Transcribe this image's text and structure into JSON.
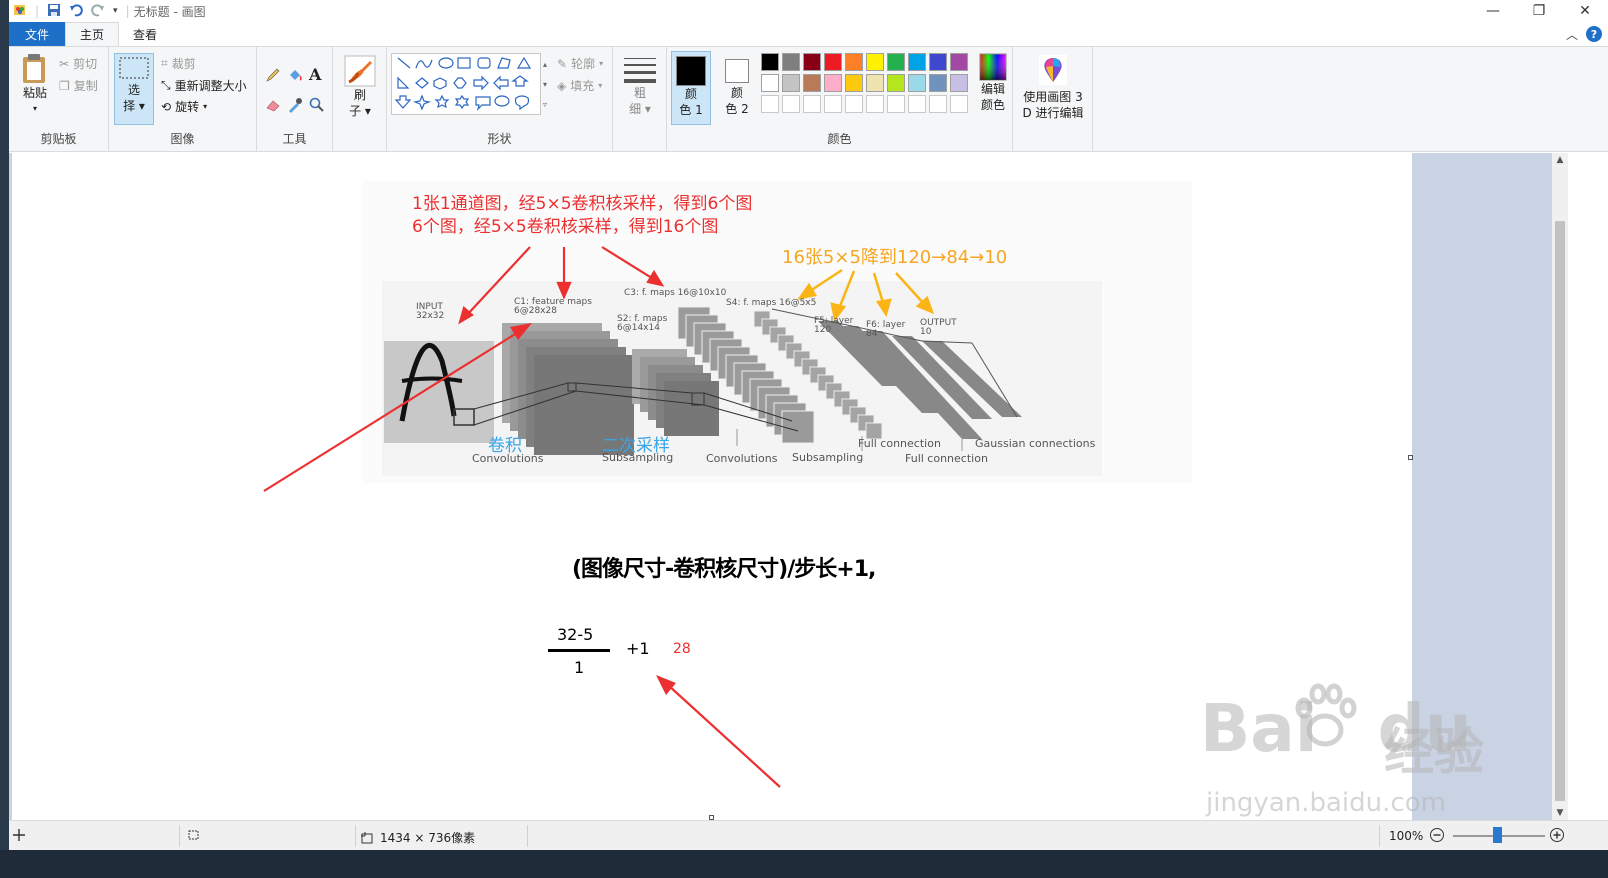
{
  "window": {
    "title": "无标题 - 画图",
    "minimize": "—",
    "restore": "❐",
    "close": "✕"
  },
  "tabs": [
    {
      "label": "文件"
    },
    {
      "label": "主页"
    },
    {
      "label": "查看"
    }
  ],
  "ribbon": {
    "clipboard": {
      "label": "剪贴板",
      "paste": "粘贴",
      "cut": "剪切",
      "copy": "复制"
    },
    "image": {
      "label": "图像",
      "select_line1": "选",
      "select_line2": "择",
      "crop": "裁剪",
      "resize": "重新调整大小",
      "rotate": "旋转"
    },
    "tools": {
      "label": "工具"
    },
    "brush": {
      "line1": "刷",
      "line2": "子"
    },
    "shapes": {
      "label": "形状",
      "outline": "轮廓",
      "fill": "填充"
    },
    "size": {
      "line1": "粗",
      "line2": "细"
    },
    "colors": {
      "label": "颜色",
      "color1_line1": "颜",
      "color1_line2": "色 1",
      "color2_line1": "颜",
      "color2_line2": "色 2",
      "edit_line1": "编辑",
      "edit_line2": "颜色",
      "palette_row1": [
        "#000000",
        "#7f7f7f",
        "#880015",
        "#ed1c24",
        "#ff7f27",
        "#fff200",
        "#22b14c",
        "#00a2e8",
        "#3f48cc",
        "#a349a4"
      ],
      "palette_row2": [
        "#ffffff",
        "#c3c3c3",
        "#b97a57",
        "#ffaec9",
        "#ffc90e",
        "#efe4b0",
        "#b5e61d",
        "#99d9ea",
        "#7092be",
        "#c8bfe7"
      ],
      "primary": "#000000",
      "secondary": "#ffffff"
    },
    "paint3d": {
      "line1": "使用画图 3",
      "line2": "D 进行编辑"
    }
  },
  "canvas_content": {
    "annotation_red_1": "1张1通道图，经5×5卷积核采样，得到6个图",
    "annotation_red_2": "6个图，经5×5卷积核采样，得到16个图",
    "annotation_orange": "16张5×5降到120→84→10",
    "diagram": {
      "input": "INPUT",
      "input_size": "32x32",
      "c1": "C1: feature maps",
      "c1_size": "6@28x28",
      "s2": "S2: f. maps",
      "s2_size": "6@14x14",
      "c3": "C3: f. maps 16@10x10",
      "s4": "S4: f. maps 16@5x5",
      "f5": "F5: layer",
      "f5_size": "120",
      "f6": "F6: layer",
      "f6_size": "84",
      "output": "OUTPUT",
      "output_size": "10",
      "conv1": "Convolutions",
      "sub1": "Subsampling",
      "conv2": "Convolutions",
      "sub2": "Subsampling",
      "full1": "Full connection",
      "full2": "Full connection",
      "gauss": "Gaussian connections",
      "blue_conv": "卷积",
      "blue_sub": "二次采样"
    },
    "formula": "(图像尺寸-卷积核尺寸)/步长+1,",
    "numerator": "32-5",
    "denominator": "1",
    "plus_one": "+1",
    "result": "28"
  },
  "watermark": {
    "brand": "Bai",
    "brand2": "du",
    "cn": "经验",
    "url": "jingyan.baidu.com"
  },
  "status": {
    "dimensions": "1434 × 736像素",
    "zoom": "100%"
  }
}
